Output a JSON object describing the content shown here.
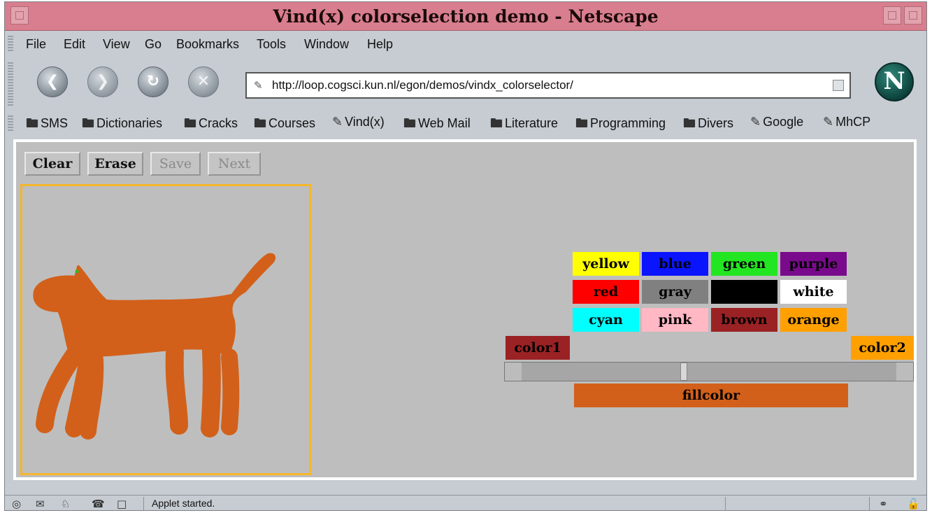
{
  "window": {
    "title": "Vind(x) colorselection demo - Netscape"
  },
  "menu": [
    "File",
    "Edit",
    "View",
    "Go",
    "Bookmarks",
    "Tools",
    "Window",
    "Help"
  ],
  "nav": {
    "back_icon": "back-arrow-icon",
    "forward_icon": "forward-arrow-icon",
    "reload_icon": "reload-icon",
    "stop_icon": "stop-icon",
    "url": "http://loop.cogsci.kun.nl/egon/demos/vindx_colorselector/",
    "logo": "N"
  },
  "bookmarks": [
    {
      "label": "SMS",
      "icon": "folder-icon"
    },
    {
      "label": "Dictionaries",
      "icon": "folder-icon"
    },
    {
      "label": "Cracks",
      "icon": "folder-icon"
    },
    {
      "label": "Courses",
      "icon": "folder-icon"
    },
    {
      "label": "Vind(x)",
      "icon": "bookmark-icon"
    },
    {
      "label": "Web Mail",
      "icon": "folder-icon"
    },
    {
      "label": "Literature",
      "icon": "folder-icon"
    },
    {
      "label": "Programming",
      "icon": "folder-icon"
    },
    {
      "label": "Divers",
      "icon": "folder-icon"
    },
    {
      "label": "Google",
      "icon": "bookmark-icon"
    },
    {
      "label": "MhCP",
      "icon": "bookmark-icon"
    }
  ],
  "applet": {
    "buttons": [
      {
        "label": "Clear",
        "enabled": true
      },
      {
        "label": "Erase",
        "enabled": true
      },
      {
        "label": "Save",
        "enabled": false
      },
      {
        "label": "Next",
        "enabled": false
      }
    ],
    "drawing_color": "#d2601a",
    "canvas_border": "#f6b52a",
    "swatches": [
      {
        "label": "yellow",
        "bg": "#ffff00",
        "fg": "#000000"
      },
      {
        "label": "blue",
        "bg": "#0a14ff",
        "fg": "#000000"
      },
      {
        "label": "green",
        "bg": "#22e622",
        "fg": "#000000"
      },
      {
        "label": "purple",
        "bg": "#7a0a8c",
        "fg": "#000000"
      },
      {
        "label": "red",
        "bg": "#ff0000",
        "fg": "#000000"
      },
      {
        "label": "gray",
        "bg": "#808080",
        "fg": "#000000"
      },
      {
        "label": "",
        "bg": "#000000",
        "fg": "#000000"
      },
      {
        "label": "white",
        "bg": "#ffffff",
        "fg": "#000000"
      },
      {
        "label": "cyan",
        "bg": "#00ffff",
        "fg": "#000000"
      },
      {
        "label": "pink",
        "bg": "#ffb8c4",
        "fg": "#000000"
      },
      {
        "label": "brown",
        "bg": "#9a2224",
        "fg": "#000000"
      },
      {
        "label": "orange",
        "bg": "#ffa000",
        "fg": "#000000"
      }
    ],
    "color1": {
      "label": "color1",
      "bg": "#9a2224"
    },
    "color2": {
      "label": "color2",
      "bg": "#ffa000"
    },
    "slider_value": 0.43,
    "fillcolor": {
      "label": "fillcolor",
      "bg": "#d2601a"
    }
  },
  "status": {
    "text": "Applet started."
  }
}
